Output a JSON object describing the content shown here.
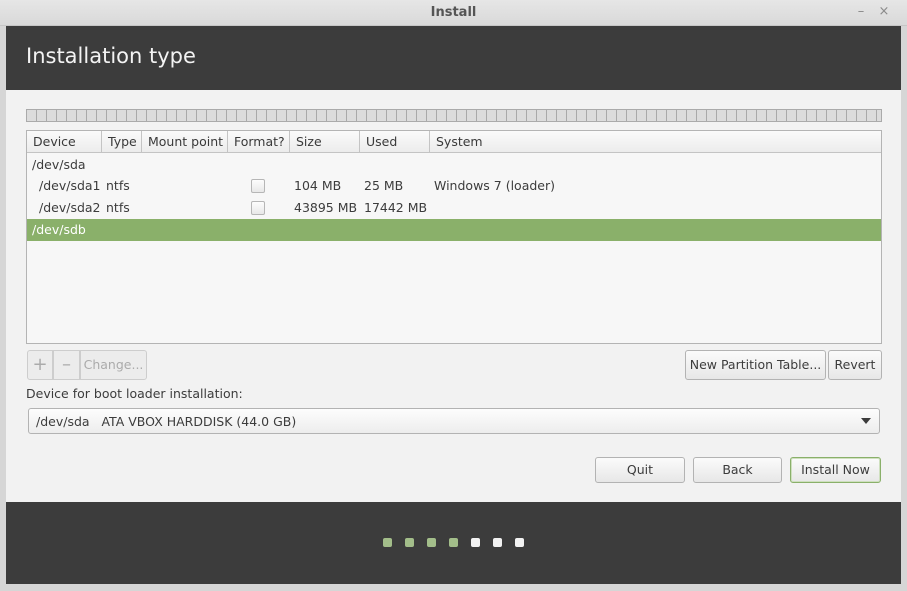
{
  "window": {
    "title": "Install",
    "minimize_icon": "–",
    "close_icon": "×"
  },
  "header": {
    "title": "Installation type"
  },
  "partition_table": {
    "columns": [
      "Device",
      "Type",
      "Mount point",
      "Format?",
      "Size",
      "Used",
      "System"
    ],
    "rows": [
      {
        "device": "/dev/sda",
        "type": "",
        "mount": "",
        "format": null,
        "size": "",
        "used": "",
        "system": "",
        "selected": false
      },
      {
        "device": "/dev/sda1",
        "type": "ntfs",
        "mount": "",
        "format": false,
        "size": "104 MB",
        "used": "25 MB",
        "system": "Windows 7 (loader)",
        "selected": false
      },
      {
        "device": "/dev/sda2",
        "type": "ntfs",
        "mount": "",
        "format": false,
        "size": "43895 MB",
        "used": "17442 MB",
        "system": "",
        "selected": false
      },
      {
        "device": "/dev/sdb",
        "type": "",
        "mount": "",
        "format": null,
        "size": "",
        "used": "",
        "system": "",
        "selected": true
      }
    ]
  },
  "toolbar": {
    "add_label": "+",
    "remove_label": "–",
    "change_label": "Change...",
    "new_table_label": "New Partition Table...",
    "revert_label": "Revert"
  },
  "bootloader": {
    "label": "Device for boot loader installation:",
    "selected": "/dev/sda   ATA VBOX HARDDISK (44.0 GB)"
  },
  "actions": {
    "quit_label": "Quit",
    "back_label": "Back",
    "install_label": "Install Now"
  },
  "progress": {
    "steps_done": 4,
    "steps_total": 7
  },
  "colors": {
    "accent": "#8ab06a",
    "header_bg": "#3c3c3c",
    "done_dot": "#a3be8a",
    "todo_dot": "#f2f2f2"
  }
}
